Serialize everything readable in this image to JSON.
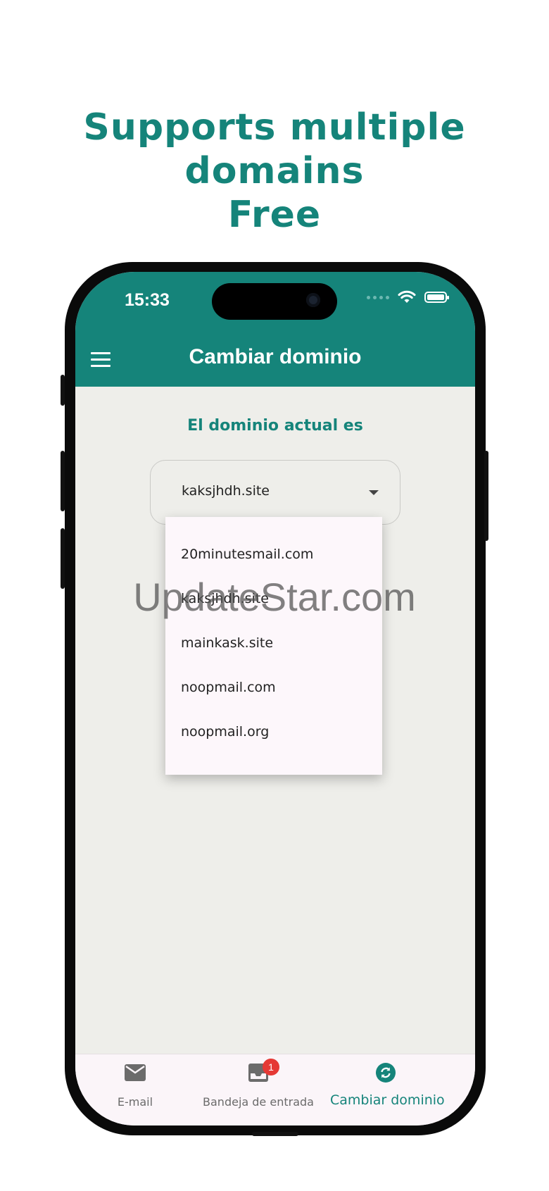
{
  "headline": {
    "line1": "Supports multiple domains",
    "line2": "Free"
  },
  "status_bar": {
    "time": "15:33",
    "icons": [
      "signal-dots-icon",
      "wifi-icon",
      "battery-icon"
    ]
  },
  "app_bar": {
    "title": "Cambiar dominio",
    "menu_icon": "menu-icon"
  },
  "main": {
    "current_domain_label": "El dominio actual es",
    "selected_domain": "kaksjhdh.site",
    "dropdown_options": [
      "20minutesmail.com",
      "kaksjhdh.site",
      "mainkask.site",
      "noopmail.com",
      "noopmail.org"
    ]
  },
  "bottom_nav": {
    "items": [
      {
        "label": "E-mail",
        "icon": "mail-icon"
      },
      {
        "label": "Bandeja de entrada",
        "icon": "inbox-icon",
        "badge": "1"
      },
      {
        "label": "Cambiar dominio",
        "icon": "sync-icon"
      }
    ],
    "active_index": 2
  },
  "watermark": "UpdateStar.com",
  "colors": {
    "primary": "#15847a",
    "screen_bg": "#eeeeea",
    "menu_bg": "#fdf7fb",
    "badge": "#e53935"
  }
}
